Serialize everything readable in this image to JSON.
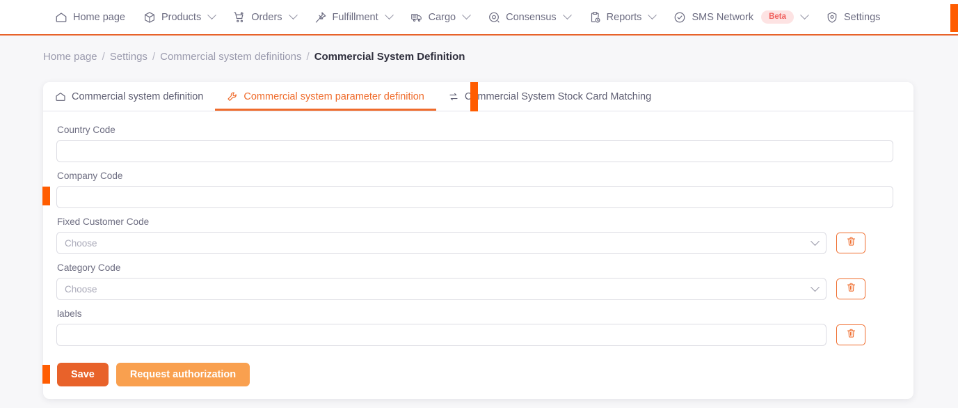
{
  "nav": {
    "items": [
      {
        "label": "Home page",
        "icon": "home-icon",
        "caret": false,
        "badge": null
      },
      {
        "label": "Products",
        "icon": "box-icon",
        "caret": true,
        "badge": null
      },
      {
        "label": "Orders",
        "icon": "cart-plus-icon",
        "caret": true,
        "badge": null
      },
      {
        "label": "Fulfillment",
        "icon": "pin-icon",
        "caret": true,
        "badge": null
      },
      {
        "label": "Cargo",
        "icon": "truck-icon",
        "caret": true,
        "badge": null
      },
      {
        "label": "Consensus",
        "icon": "target-icon",
        "caret": true,
        "badge": null
      },
      {
        "label": "Reports",
        "icon": "clipboard-clock-icon",
        "caret": true,
        "badge": null
      },
      {
        "label": "SMS Network",
        "icon": "check-circle-icon",
        "caret": true,
        "badge": "Beta"
      },
      {
        "label": "Settings",
        "icon": "shield-gear-icon",
        "caret": false,
        "badge": null
      }
    ]
  },
  "breadcrumb": {
    "items": [
      {
        "label": "Home page",
        "current": false
      },
      {
        "label": "Settings",
        "current": false
      },
      {
        "label": "Commercial system definitions",
        "current": false
      },
      {
        "label": "Commercial System Definition",
        "current": true
      }
    ],
    "separator": "/"
  },
  "tabs": [
    {
      "label": "Commercial system definition",
      "icon": "home-icon",
      "active": false
    },
    {
      "label": "Commercial system parameter definition",
      "icon": "wrench-icon",
      "active": true
    },
    {
      "label": "Commercial System Stock Card Matching",
      "icon": "exchange-icon",
      "active": false
    }
  ],
  "form": {
    "country_code": {
      "label": "Country Code",
      "value": "",
      "placeholder": ""
    },
    "company_code": {
      "label": "Company Code",
      "value": "",
      "placeholder": ""
    },
    "fixed_customer_code": {
      "label": "Fixed Customer Code",
      "value": "",
      "placeholder": "Choose"
    },
    "category_code": {
      "label": "Category Code",
      "value": "",
      "placeholder": "Choose"
    },
    "labels": {
      "label": "labels",
      "value": "",
      "placeholder": ""
    },
    "delete_icon": "trash-icon"
  },
  "actions": {
    "save_label": "Save",
    "request_label": "Request authorization"
  },
  "colors": {
    "accent": "#ef6b2b",
    "save": "#e8622a",
    "request": "#f9a04f",
    "marker": "#ff5c00",
    "badge_bg": "#fde3e3",
    "badge_text": "#f0605d",
    "text": "#6b6b80",
    "page_bg": "#f7f7f9"
  }
}
